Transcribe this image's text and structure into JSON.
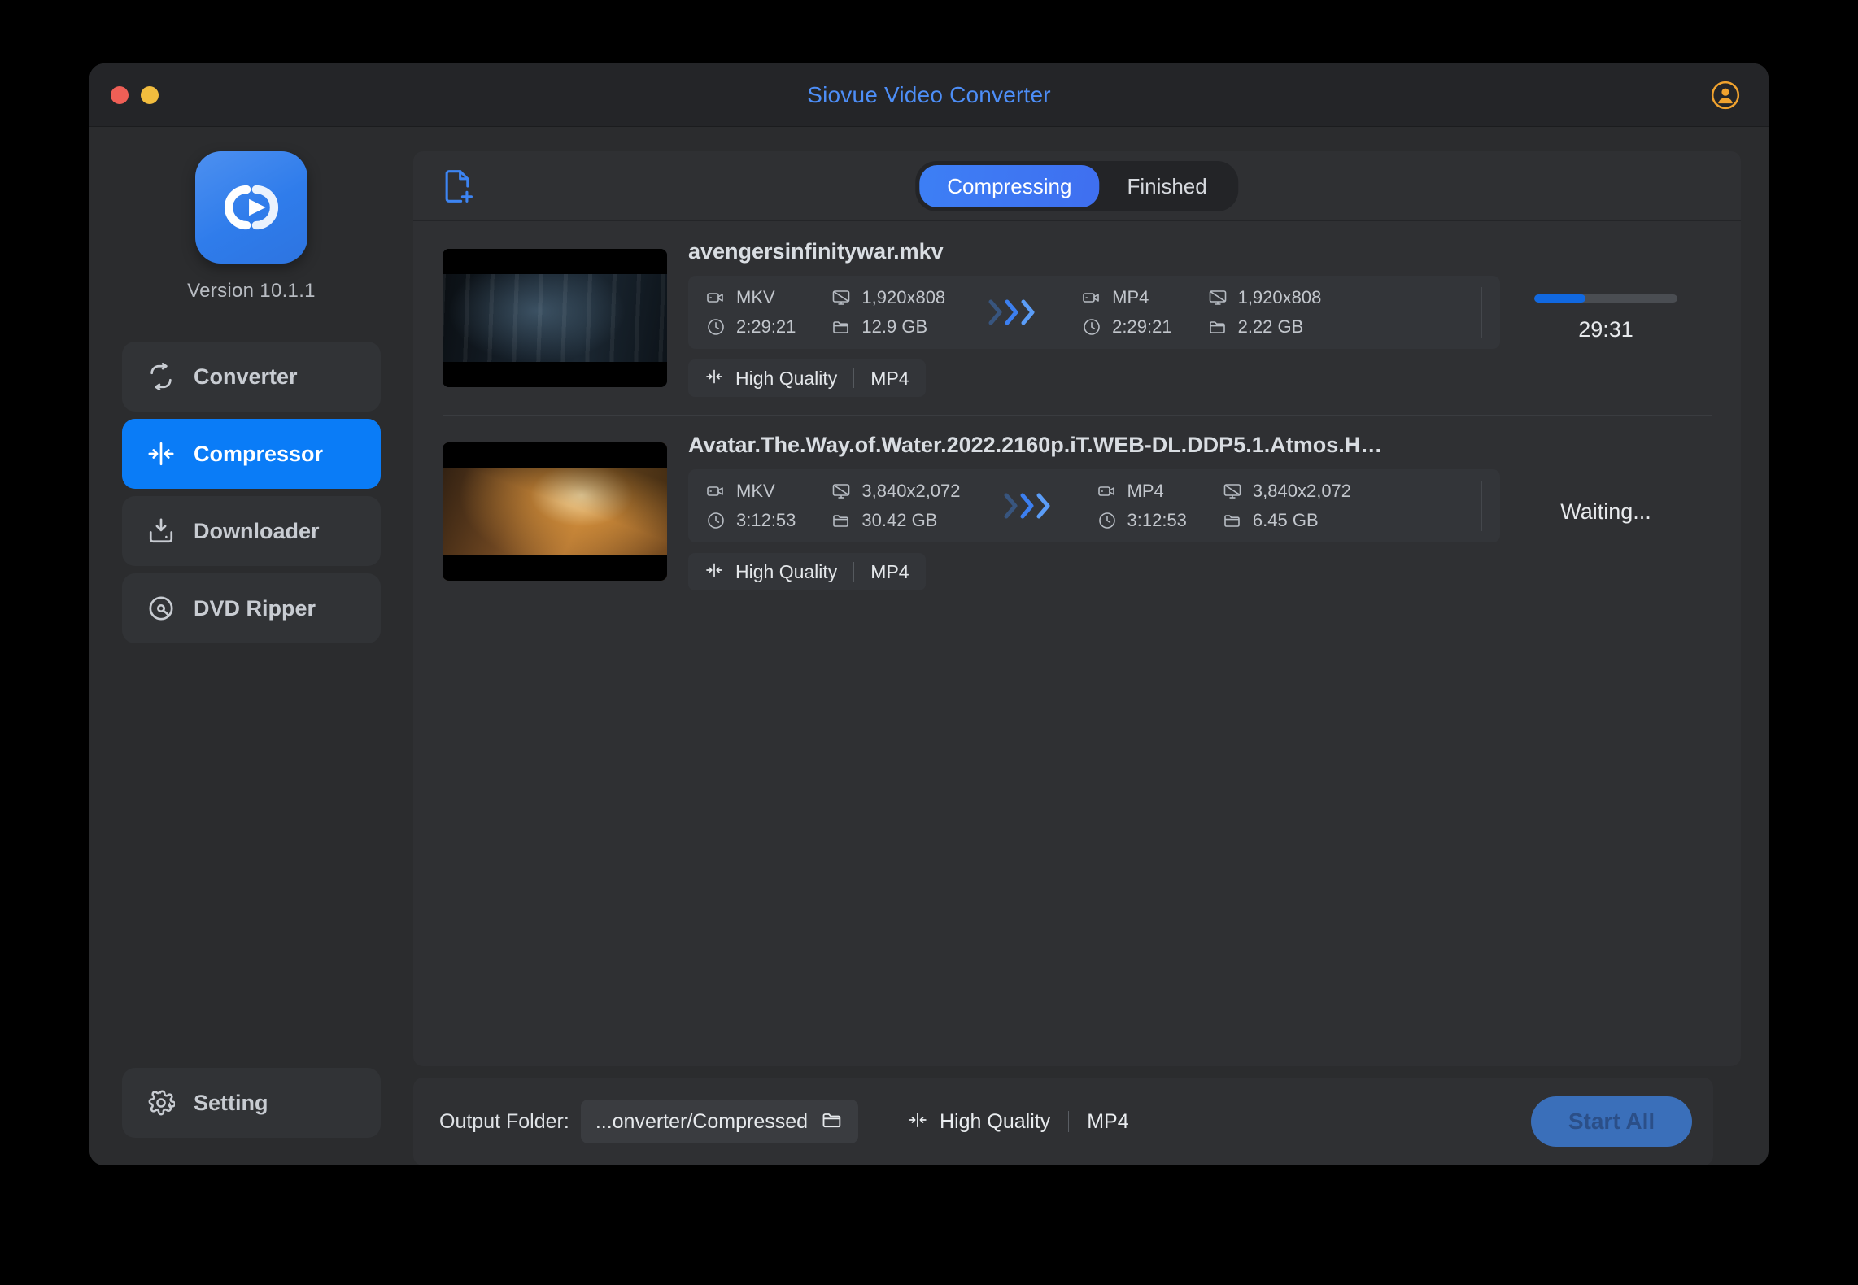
{
  "window": {
    "title": "Siovue Video Converter",
    "title_color": "#4d8ef7",
    "traffic_lights": [
      "close",
      "minimize"
    ],
    "account_icon": "account-circle-icon"
  },
  "sidebar": {
    "logo_icon": "app-logo-icon",
    "version": "Version 10.1.1",
    "items": [
      {
        "label": "Converter",
        "icon": "convert-loop-icon",
        "active": false
      },
      {
        "label": "Compressor",
        "icon": "compress-icon",
        "active": true
      },
      {
        "label": "Downloader",
        "icon": "download-tray-icon",
        "active": false
      },
      {
        "label": "DVD Ripper",
        "icon": "disc-icon",
        "active": false
      }
    ],
    "setting": {
      "label": "Setting",
      "icon": "gear-icon"
    },
    "accent": "#0a7cf7"
  },
  "toolbar": {
    "add_file_icon": "add-file-icon",
    "tabs": [
      {
        "label": "Compressing",
        "active": true
      },
      {
        "label": "Finished",
        "active": false
      }
    ]
  },
  "files": [
    {
      "name": "avengersinfinitywar.mkv",
      "thumbnail": "dark-blue-scene",
      "source": {
        "format": "MKV",
        "resolution": "1,920x808",
        "duration": "2:29:21",
        "size": "12.9 GB"
      },
      "target": {
        "format": "MP4",
        "resolution": "1,920x808",
        "duration": "2:29:21",
        "size": "2.22 GB"
      },
      "arrow_icon": "chevrons-right-icon",
      "tag": {
        "quality": "High Quality",
        "format": "MP4",
        "icon": "compress-icon"
      },
      "status": {
        "type": "progress",
        "percent": 36,
        "time": "29:31"
      }
    },
    {
      "name": "Avatar.The.Way.of.Water.2022.2160p.iT.WEB-DL.DDP5.1.Atmos.H…",
      "thumbnail": "warm-orange-scene",
      "source": {
        "format": "MKV",
        "resolution": "3,840x2,072",
        "duration": "3:12:53",
        "size": "30.42 GB"
      },
      "target": {
        "format": "MP4",
        "resolution": "3,840x2,072",
        "duration": "3:12:53",
        "size": "6.45 GB"
      },
      "arrow_icon": "chevrons-right-icon",
      "tag": {
        "quality": "High Quality",
        "format": "MP4",
        "icon": "compress-icon"
      },
      "status": {
        "type": "waiting",
        "text": "Waiting..."
      }
    }
  ],
  "meta_icons": {
    "format": "video-camera-icon",
    "resolution": "monitor-icon",
    "duration": "clock-icon",
    "size": "folder-icon"
  },
  "footer": {
    "output_label": "Output Folder:",
    "output_path": "...onverter/Compressed",
    "folder_icon": "folder-icon",
    "tag": {
      "quality": "High Quality",
      "format": "MP4",
      "icon": "compress-icon"
    },
    "start_button": "Start All",
    "start_button_disabled": true
  }
}
